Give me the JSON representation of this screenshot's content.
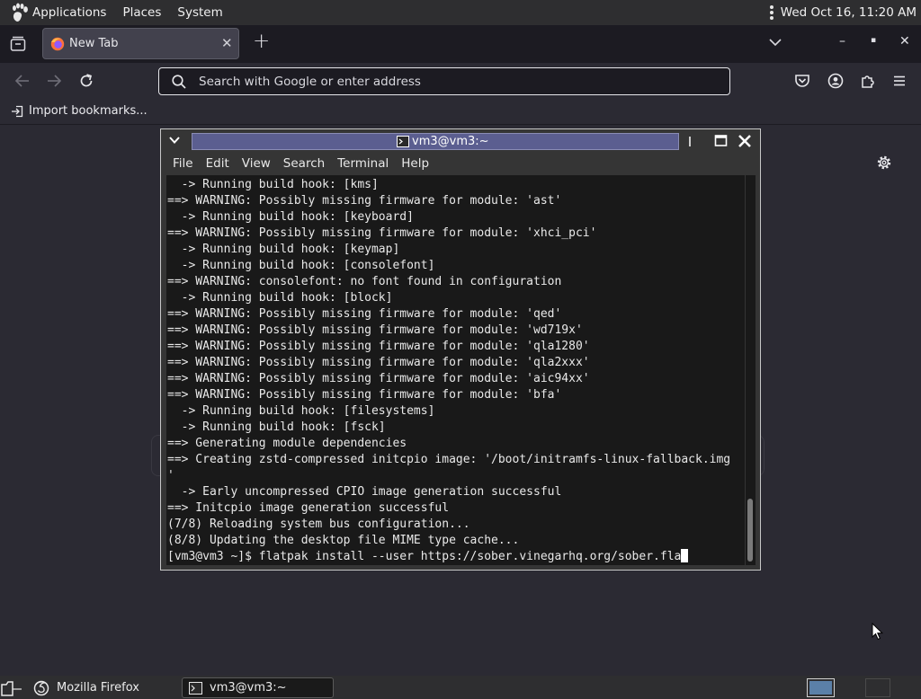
{
  "top_panel": {
    "applications": "Applications",
    "places": "Places",
    "system": "System",
    "clock": "Wed Oct 16, 11:20 AM"
  },
  "browser": {
    "tab": {
      "title": "New Tab",
      "close": "✕"
    },
    "new_tab": "+",
    "window_controls": {
      "minimize": "–",
      "maximize": "▪",
      "close": "✕"
    },
    "url_placeholder": "Search with Google or enter address",
    "bookmarks": {
      "import": "Import bookmarks..."
    }
  },
  "terminal": {
    "title": "vm3@vm3:~",
    "menu": [
      "File",
      "Edit",
      "View",
      "Search",
      "Terminal",
      "Help"
    ],
    "lines": [
      "  -> Running build hook: [kms]",
      "==> WARNING: Possibly missing firmware for module: 'ast'",
      "  -> Running build hook: [keyboard]",
      "==> WARNING: Possibly missing firmware for module: 'xhci_pci'",
      "  -> Running build hook: [keymap]",
      "  -> Running build hook: [consolefont]",
      "==> WARNING: consolefont: no font found in configuration",
      "  -> Running build hook: [block]",
      "==> WARNING: Possibly missing firmware for module: 'qed'",
      "==> WARNING: Possibly missing firmware for module: 'wd719x'",
      "==> WARNING: Possibly missing firmware for module: 'qla1280'",
      "==> WARNING: Possibly missing firmware for module: 'qla2xxx'",
      "==> WARNING: Possibly missing firmware for module: 'aic94xx'",
      "==> WARNING: Possibly missing firmware for module: 'bfa'",
      "  -> Running build hook: [filesystems]",
      "  -> Running build hook: [fsck]",
      "==> Generating module dependencies",
      "==> Creating zstd-compressed initcpio image: '/boot/initramfs-linux-fallback.img",
      "'",
      "  -> Early uncompressed CPIO image generation successful",
      "==> Initcpio image generation successful",
      "(7/8) Reloading system bus configuration...",
      "(8/8) Updating the desktop file MIME type cache..."
    ],
    "prompt_line": "[vm3@vm3 ~]$ flatpak install --user https://sober.vinegarhq.org/sober.fla"
  },
  "taskbar": {
    "firefox": "Mozilla Firefox",
    "terminal": "vm3@vm3:~"
  },
  "colors": {
    "panel": "#2e2e30",
    "browser_chrome": "#2b2a33",
    "terminal_title_active": "#5b5e90",
    "terminal_bg": "#191919",
    "workspace_active": "#5b80a8"
  },
  "icons": {
    "panel_logo": "gnome-foot-icon",
    "firefox": "firefox-icon",
    "terminal": "terminal-icon",
    "settings": "gear-icon"
  }
}
